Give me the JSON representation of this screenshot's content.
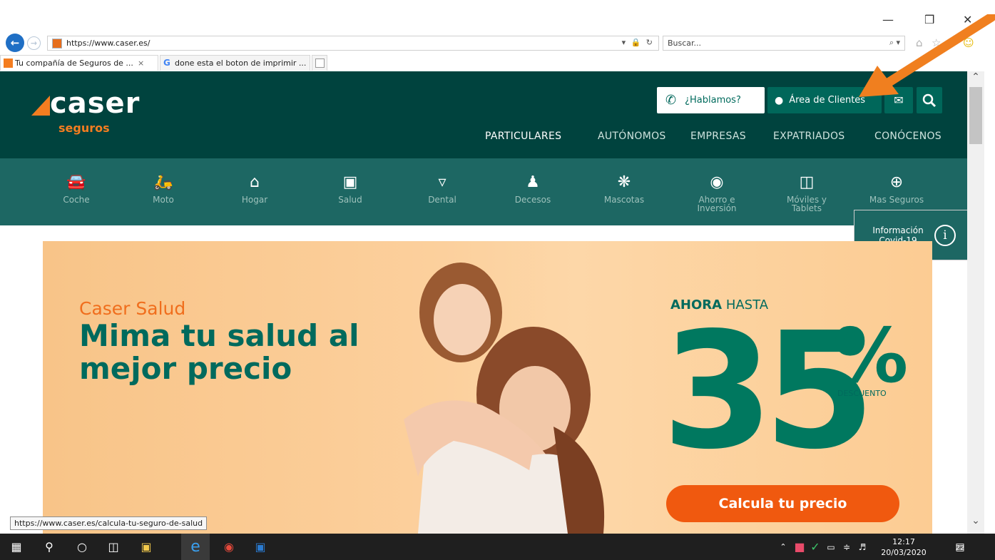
{
  "browser": {
    "url": "https://www.caser.es/",
    "search_placeholder": "Buscar...",
    "search_tool": "⌕ ▾",
    "addr_tools": "▾ 🔒 ↻",
    "window_controls": {
      "minimize": "—",
      "restore": "❒",
      "close": "✕"
    },
    "tabs": [
      {
        "label": "Tu compañía de Seguros de ...",
        "close": "×"
      },
      {
        "label": "done esta el boton de imprimir ..."
      }
    ],
    "status_url": "https://www.caser.es/calcula-tu-seguro-de-salud"
  },
  "site": {
    "logo": {
      "word": "caser",
      "sub": "seguros"
    },
    "header_buttons": {
      "hablamos": "¿Hablamos?",
      "clientes": "Área de Clientes"
    },
    "top_nav": [
      "PARTICULARES",
      "AUTÓNOMOS",
      "EMPRESAS",
      "EXPATRIADOS",
      "CONÓCENOS"
    ],
    "product_nav": [
      {
        "label": "Coche",
        "icon": "car-icon"
      },
      {
        "label": "Moto",
        "icon": "scooter-icon"
      },
      {
        "label": "Hogar",
        "icon": "house-icon"
      },
      {
        "label": "Salud",
        "icon": "medical-bag-icon"
      },
      {
        "label": "Dental",
        "icon": "tooth-icon"
      },
      {
        "label": "Decesos",
        "icon": "family-icon"
      },
      {
        "label": "Mascotas",
        "icon": "paw-icon"
      },
      {
        "label": "Ahorro e Inversión",
        "icon": "piggy-bank-icon"
      },
      {
        "label": "Móviles y Tablets",
        "icon": "mobile-tablet-icon"
      },
      {
        "label": "Mas Seguros",
        "icon": "plus-circle-icon"
      }
    ],
    "covid": {
      "label": "Información Covid-19"
    },
    "hero": {
      "kicker": "Caser Salud",
      "title": "Mima tu salud al mejor precio",
      "ahora_bold": "AHORA",
      "ahora_rest": " HASTA",
      "big_number": "35",
      "percent": "%",
      "descuento": "DESCUENTO",
      "cta": "Calcula tu precio"
    }
  },
  "taskbar": {
    "time": "12:17",
    "date": "20/03/2020",
    "notifications": "22"
  },
  "colors": {
    "header": "#00433e",
    "product_nav": "#1d6763",
    "accent_orange": "#f47d20",
    "hero_bg": "#fbc98a",
    "green_text": "#006a5d",
    "cta": "#f0590f"
  }
}
